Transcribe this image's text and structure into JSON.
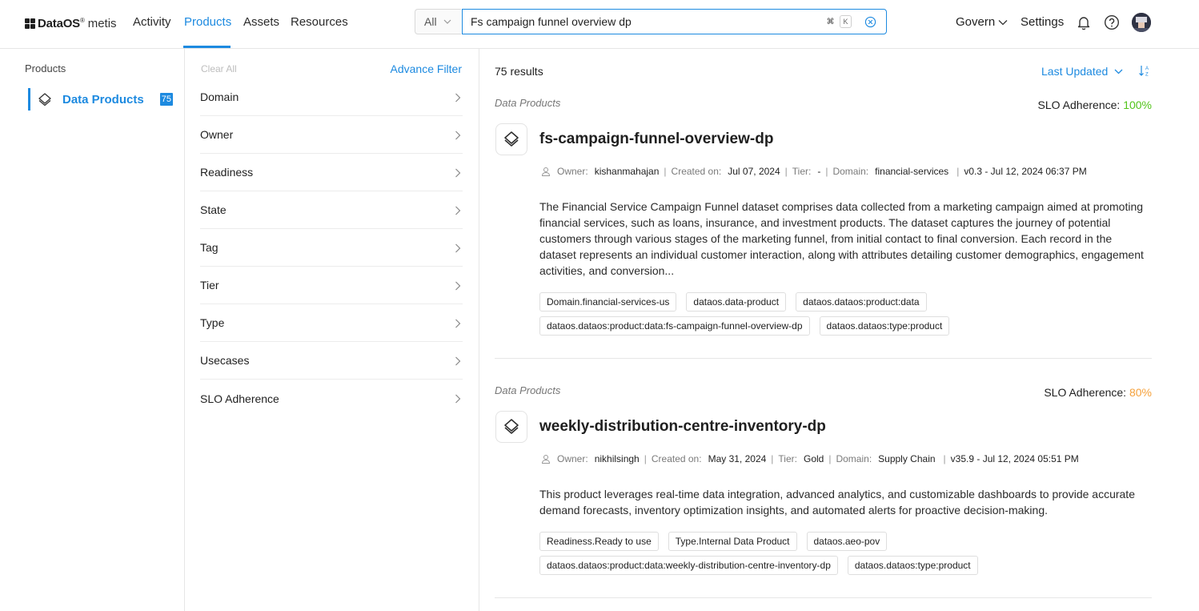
{
  "brand": {
    "name": "DataOS",
    "sup": "®",
    "product": "metis"
  },
  "nav": {
    "links": [
      "Activity",
      "Products",
      "Assets",
      "Resources"
    ],
    "active": "Products"
  },
  "search": {
    "scope": "All",
    "query": "Fs campaign funnel overview dp",
    "shortcut_cmd": "⌘",
    "shortcut_key": "K"
  },
  "header_right": {
    "govern": "Govern",
    "settings": "Settings"
  },
  "sidebar": {
    "title": "Products",
    "items": [
      {
        "label": "Data Products",
        "count": "75"
      }
    ]
  },
  "filters": {
    "clear_all": "Clear All",
    "advance_filter": "Advance Filter",
    "items": [
      "Domain",
      "Owner",
      "Readiness",
      "State",
      "Tag",
      "Tier",
      "Type",
      "Usecases",
      "SLO Adherence"
    ]
  },
  "results": {
    "count_label": "75 results",
    "sort_label": "Last Updated",
    "cards": [
      {
        "kind": "Data Products",
        "slo_label": "SLO Adherence:",
        "slo_value": "100%",
        "slo_color": "#52c41a",
        "title": "fs-campaign-funnel-overview-dp",
        "owner_label": "Owner:",
        "owner": "kishanmahajan",
        "created_label": "Created on:",
        "created": "Jul 07, 2024",
        "tier_label": "Tier:",
        "tier": "-",
        "domain_label": "Domain:",
        "domain": "financial-services",
        "version": "v0.3 - Jul 12, 2024 06:37 PM",
        "description": "The Financial Service Campaign Funnel dataset comprises data collected from a marketing campaign aimed at promoting financial services, such as loans, insurance, and investment products. The dataset captures the journey of potential customers through various stages of the marketing funnel, from initial contact to final conversion. Each record in the dataset represents an individual customer interaction, along with attributes detailing customer demographics, engagement activities, and conversion...",
        "tags": [
          "Domain.financial-services-us",
          "dataos.data-product",
          "dataos.dataos:product:data",
          "dataos.dataos:product:data:fs-campaign-funnel-overview-dp",
          "dataos.dataos:type:product"
        ]
      },
      {
        "kind": "Data Products",
        "slo_label": "SLO Adherence:",
        "slo_value": "80%",
        "slo_color": "#f5a13c",
        "title": "weekly-distribution-centre-inventory-dp",
        "owner_label": "Owner:",
        "owner": "nikhilsingh",
        "created_label": "Created on:",
        "created": "May 31, 2024",
        "tier_label": "Tier:",
        "tier": "Gold",
        "domain_label": "Domain:",
        "domain": "Supply Chain",
        "version": "v35.9 - Jul 12, 2024 05:51 PM",
        "description": "This product leverages real-time data integration, advanced analytics, and customizable dashboards to provide accurate demand forecasts, inventory optimization insights, and automated alerts for proactive decision-making.",
        "tags": [
          "Readiness.Ready to use",
          "Type.Internal Data Product",
          "dataos.aeo-pov",
          "dataos.dataos:product:data:weekly-distribution-centre-inventory-dp",
          "dataos.dataos:type:product"
        ]
      }
    ]
  },
  "colors": {
    "accent": "#1d8ae0",
    "border": "#e6e6e6"
  }
}
